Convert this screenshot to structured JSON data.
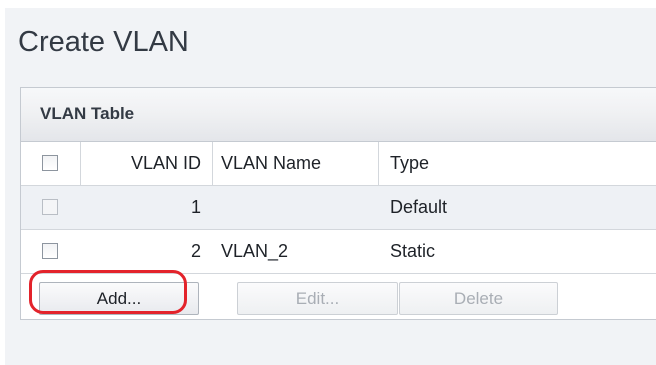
{
  "page": {
    "title": "Create VLAN"
  },
  "table": {
    "caption": "VLAN Table",
    "columns": {
      "vlan_id": "VLAN ID",
      "vlan_name": "VLAN Name",
      "type": "Type"
    },
    "rows": [
      {
        "vlan_id": "1",
        "vlan_name": "",
        "type": "Default",
        "checked": false
      },
      {
        "vlan_id": "2",
        "vlan_name": "VLAN_2",
        "type": "Static",
        "checked": false
      }
    ]
  },
  "buttons": {
    "add": "Add...",
    "edit": "Edit...",
    "delete": "Delete"
  },
  "colors": {
    "highlight": "#e3232b",
    "page_bg": "#f1f3f6",
    "header_bg": "#e4e6ea"
  }
}
